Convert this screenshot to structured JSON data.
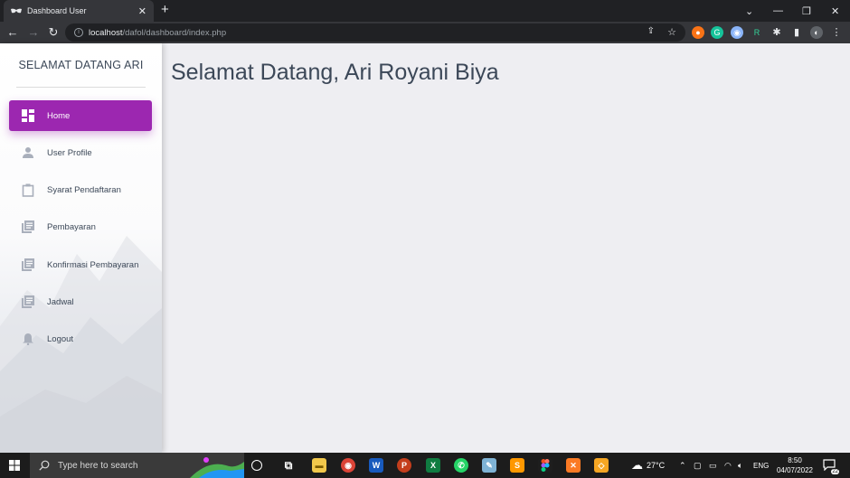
{
  "browser": {
    "tab_title": "Dashboard User",
    "tab_close": "✕",
    "new_tab": "+",
    "url_host": "localhost",
    "url_path": "/dafol/dashboard/index.php",
    "window_controls": {
      "chevron": "⌄",
      "minimize": "—",
      "restore": "❐",
      "close": "✕"
    }
  },
  "sidebar": {
    "brand": "SELAMAT DATANG ARI",
    "items": [
      {
        "label": "Home",
        "icon": "dashboard-icon",
        "active": true
      },
      {
        "label": "User Profile",
        "icon": "person-icon",
        "active": false
      },
      {
        "label": "Syarat Pendaftaran",
        "icon": "clipboard-icon",
        "active": false
      },
      {
        "label": "Pembayaran",
        "icon": "library-books-icon",
        "active": false
      },
      {
        "label": "Konfirmasi Pembayaran",
        "icon": "library-books-icon",
        "active": false
      },
      {
        "label": "Jadwal",
        "icon": "library-books-icon",
        "active": false
      },
      {
        "label": "Logout",
        "icon": "bell-icon",
        "active": false
      }
    ]
  },
  "main": {
    "heading": "Selamat Datang, Ari Royani Biya"
  },
  "taskbar": {
    "search_placeholder": "Type here to search",
    "weather": "27°C",
    "language": "ENG",
    "time": "8:50",
    "date": "04/07/2022",
    "notification_count": "22"
  },
  "colors": {
    "accent": "#9c27b0",
    "page_bg": "#eeeef2",
    "text": "#3c4858"
  }
}
